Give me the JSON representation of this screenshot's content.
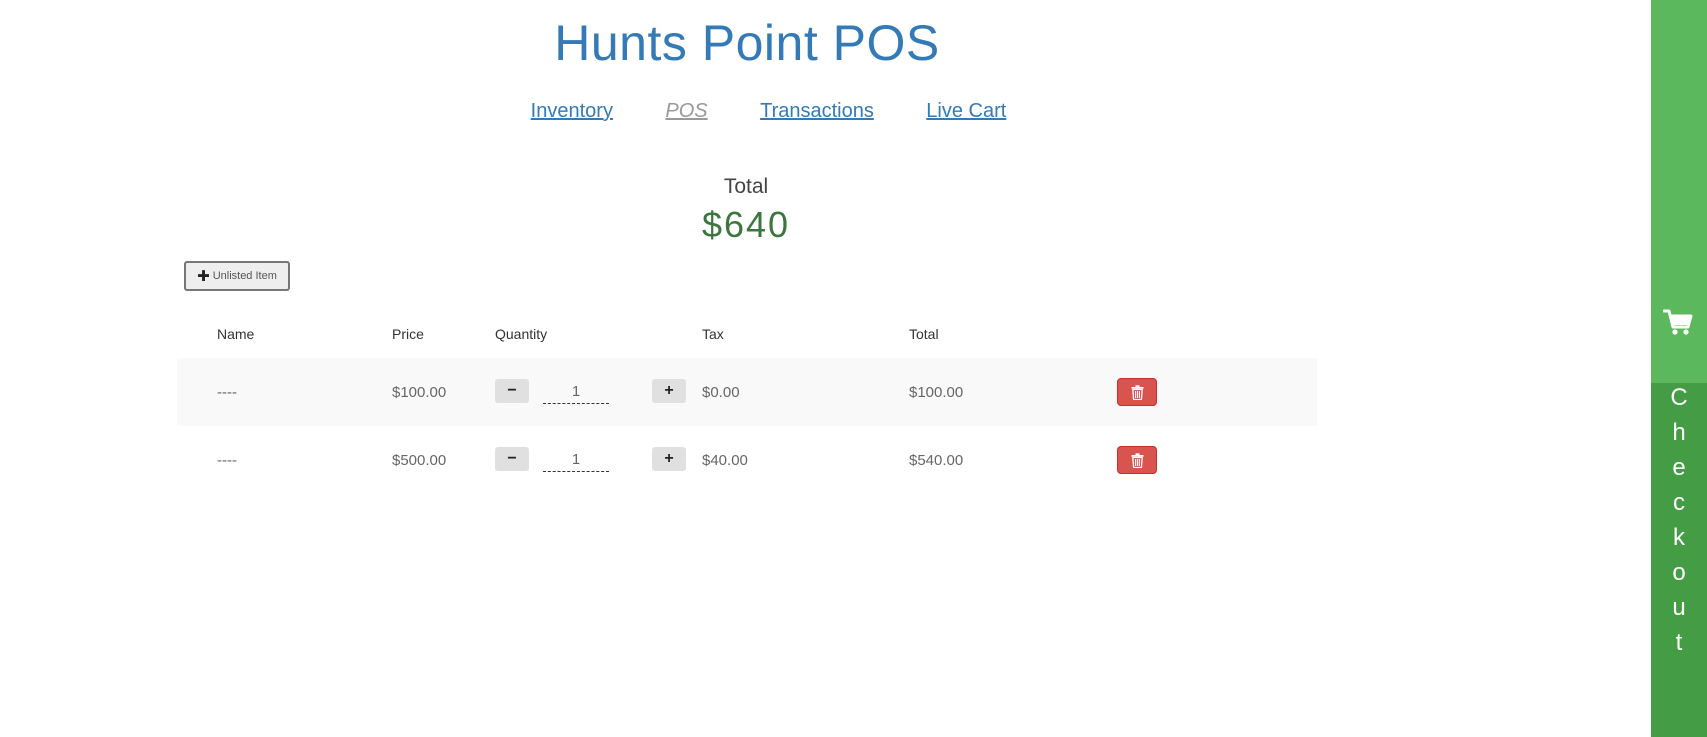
{
  "app": {
    "title": "Hunts Point POS"
  },
  "nav": {
    "items": [
      {
        "label": "Inventory",
        "active": false
      },
      {
        "label": "POS",
        "active": true
      },
      {
        "label": "Transactions",
        "active": false
      },
      {
        "label": "Live Cart",
        "active": false
      }
    ]
  },
  "summary": {
    "label": "Total",
    "amount": "$640"
  },
  "toolbar": {
    "unlisted_label": "Unlisted Item",
    "unlisted_icon": "plus-icon"
  },
  "table": {
    "headers": {
      "name": "Name",
      "price": "Price",
      "quantity": "Quantity",
      "tax": "Tax",
      "total": "Total"
    },
    "rows": [
      {
        "name": "----",
        "price": "$100.00",
        "quantity": "1",
        "tax": "$0.00",
        "total": "$100.00"
      },
      {
        "name": "----",
        "price": "$500.00",
        "quantity": "1",
        "tax": "$40.00",
        "total": "$540.00"
      }
    ],
    "minus_label": "−",
    "plus_label": "+"
  },
  "checkout": {
    "label": "Checkout",
    "icon": "cart-icon"
  },
  "colors": {
    "brand": "#337ab7",
    "total": "#3c763d",
    "checkout": "#5cb85c",
    "danger": "#d9534f"
  }
}
